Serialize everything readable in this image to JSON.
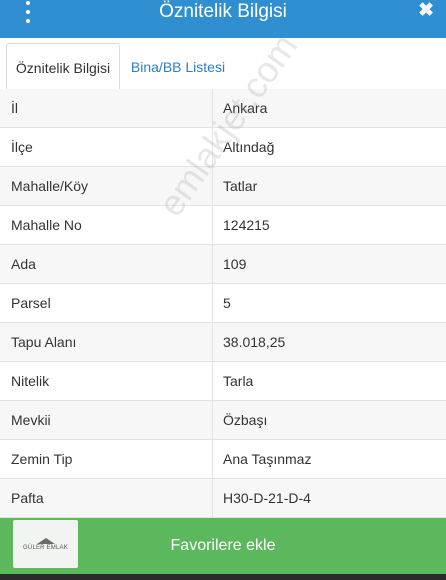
{
  "header": {
    "title": "Öznitelik Bilgisi",
    "close_symbol": "✖"
  },
  "tabs": [
    {
      "label": "Öznitelik Bilgisi",
      "active": true
    },
    {
      "label": "Bina/BB Listesi",
      "active": false
    }
  ],
  "rows": [
    {
      "key": "İl",
      "value": "Ankara"
    },
    {
      "key": "İlçe",
      "value": "Altındağ"
    },
    {
      "key": "Mahalle/Köy",
      "value": "Tatlar"
    },
    {
      "key": "Mahalle No",
      "value": "124215"
    },
    {
      "key": "Ada",
      "value": "109"
    },
    {
      "key": "Parsel",
      "value": "5"
    },
    {
      "key": "Tapu Alanı",
      "value": "38.018,25"
    },
    {
      "key": "Nitelik",
      "value": "Tarla"
    },
    {
      "key": "Mevkii",
      "value": "Özbaşı"
    },
    {
      "key": "Zemin Tip",
      "value": "Ana Taşınmaz"
    },
    {
      "key": "Pafta",
      "value": "H30-D-21-D-4"
    }
  ],
  "favorites": {
    "label": "Favorilere ekle"
  },
  "logo": {
    "text": "GÜLER EMLAK"
  },
  "watermark": "emlakjet.com",
  "colors": {
    "header": "#2f8fd0",
    "favorites": "#5cb85c",
    "tab_link": "#2f7fc0"
  }
}
